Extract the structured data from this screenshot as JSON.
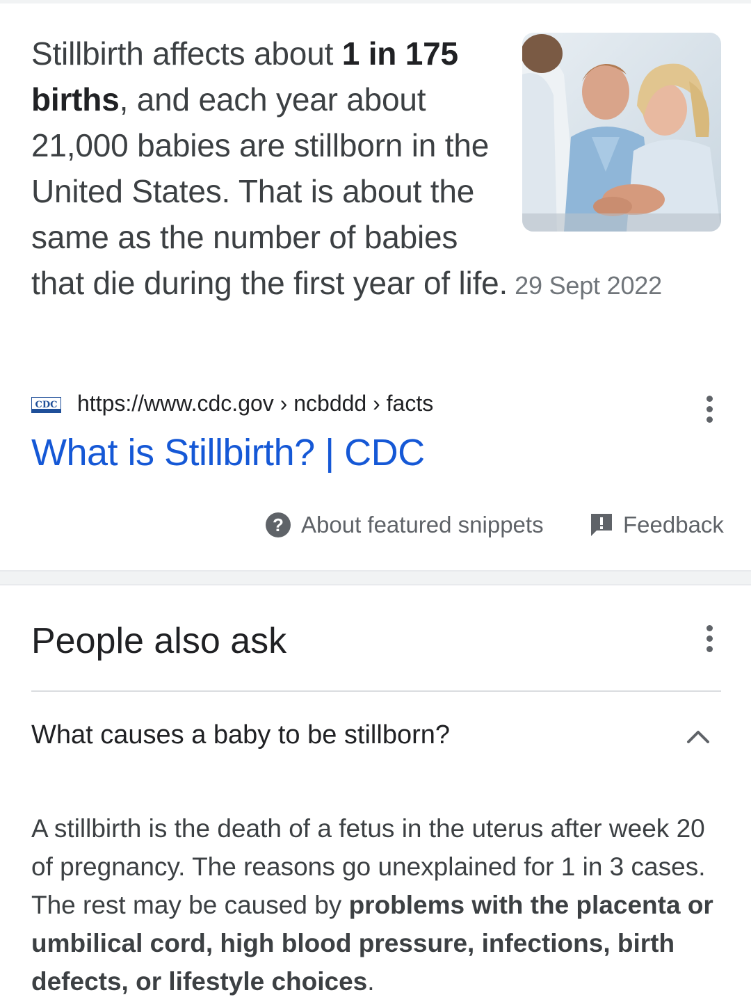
{
  "snippet": {
    "text_part1": "Stillbirth affects about ",
    "bold_part1": "1 in 175 births",
    "text_part2": ", and each year about 21,000 babies are stillborn in the United States. That is about the same as the number of babies that die during the first year of life.",
    "date": "29 Sept 2022",
    "image_alt": "photo of a doctor consulting a couple"
  },
  "source": {
    "logo_text": "CDC",
    "url": "https://www.cdc.gov › ncbddd › facts",
    "title": "What is Stillbirth? | CDC"
  },
  "footer": {
    "about_label": "About featured snippets",
    "feedback_label": "Feedback"
  },
  "paa": {
    "title": "People also ask",
    "question": "What causes a baby to be stillborn?",
    "answer_part1": "A stillbirth is the death of a fetus in the uterus after week 20 of pregnancy. The reasons go unexplained for 1 in 3 cases. The rest may be caused by ",
    "answer_bold": "problems with the placenta or umbilical cord, high blood pressure, infections, birth defects, or lifestyle choices",
    "answer_part2": "."
  },
  "colors": {
    "link_blue": "#1558d6",
    "text": "#202124",
    "secondary_text": "#5f6368",
    "divider": "#dadce0"
  }
}
